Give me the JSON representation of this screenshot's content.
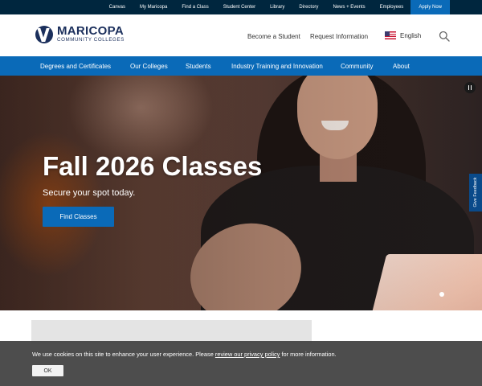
{
  "utility_nav": {
    "links": [
      "Canvas",
      "My Maricopa",
      "Find a Class",
      "Student Center",
      "Library",
      "Directory",
      "News + Events",
      "Employees"
    ],
    "apply_label": "Apply Now"
  },
  "header": {
    "logo_name": "MARICOPA",
    "logo_sub": "COMMUNITY COLLEGES",
    "become_student": "Become a Student",
    "request_info": "Request Information",
    "language": "English",
    "search_icon": "search-icon",
    "flag_icon": "us-flag-icon"
  },
  "main_nav": {
    "items": [
      "Degrees and Certificates",
      "Our Colleges",
      "Students",
      "Industry Training and Innovation",
      "Community",
      "About"
    ]
  },
  "hero": {
    "title": "Fall 2026 Classes",
    "subtitle": "Secure your spot today.",
    "cta": "Find Classes",
    "pause_icon": "pause-icon"
  },
  "feedback": {
    "label": "Give Feedback"
  },
  "cookie": {
    "text_before": "We use cookies on this site to enhance your user experience. Please ",
    "link": "review our privacy policy",
    "text_after": " for more information.",
    "ok": "OK"
  },
  "colors": {
    "utility_bar": "#00263e",
    "brand_blue": "#0a6ab8",
    "logo_navy": "#1b2f5c",
    "cookie_bar": "#424242"
  }
}
